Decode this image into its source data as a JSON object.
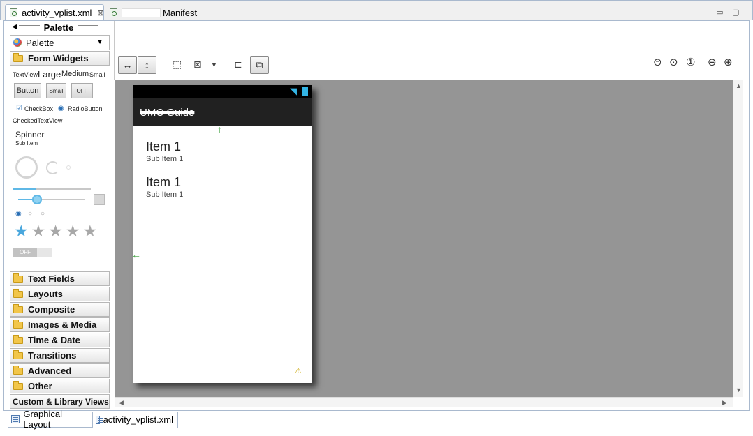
{
  "editor_tabs": [
    {
      "label": "activity_vplist.xml",
      "close": "⊠"
    },
    {
      "label": "Manifest"
    }
  ],
  "window_controls": {
    "minimize": "▭",
    "maximize": "▢"
  },
  "palette": {
    "header": "Palette",
    "selector": "Palette",
    "form_widgets": {
      "label": "Form Widgets",
      "text_sizes": [
        "TextView",
        "Large",
        "Medium",
        "Small"
      ],
      "buttons": [
        "Button",
        "Small",
        "OFF"
      ],
      "checkbox": "CheckBox",
      "radio": "RadioButton",
      "checked_text_view": "CheckedTextView",
      "spinner": "Spinner",
      "spinner_sub": "Sub Item",
      "switch_off": "OFF"
    },
    "categories": [
      "Text Fields",
      "Layouts",
      "Composite",
      "Images & Media",
      "Time & Date",
      "Transitions",
      "Advanced",
      "Other"
    ],
    "custom_views": "Custom & Library Views"
  },
  "device": {
    "action_bar_title": "UMC Guide",
    "items": [
      {
        "title": "Item 1",
        "sub": "Sub Item 1"
      },
      {
        "title": "Item 1",
        "sub": "Sub Item 1"
      }
    ],
    "warning": "⚠"
  },
  "bottom_tabs": [
    "Graphical Layout",
    "activity_vplist.xml"
  ],
  "rating_stars": 5,
  "rating_filled": 1
}
